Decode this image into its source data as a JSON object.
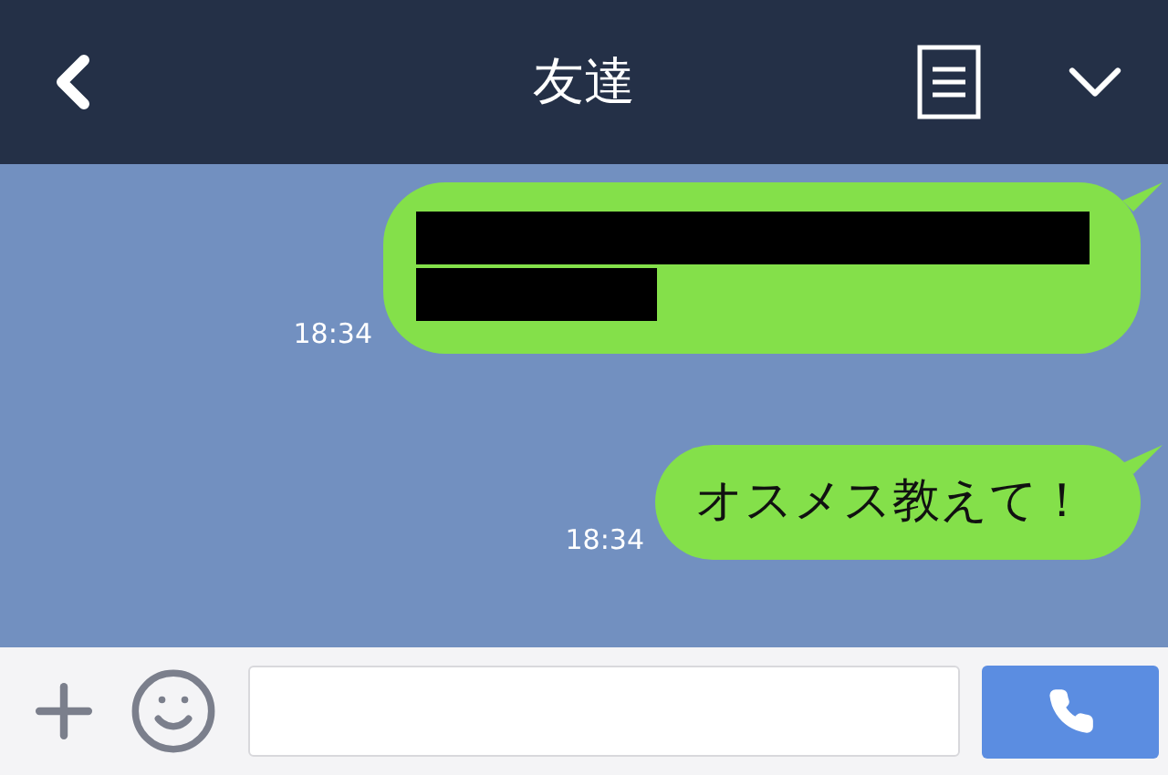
{
  "header": {
    "title": "友達"
  },
  "messages": [
    {
      "kind": "redacted",
      "time": "18:34"
    },
    {
      "kind": "text",
      "text": "オスメス教えて！",
      "time": "18:34"
    }
  ]
}
